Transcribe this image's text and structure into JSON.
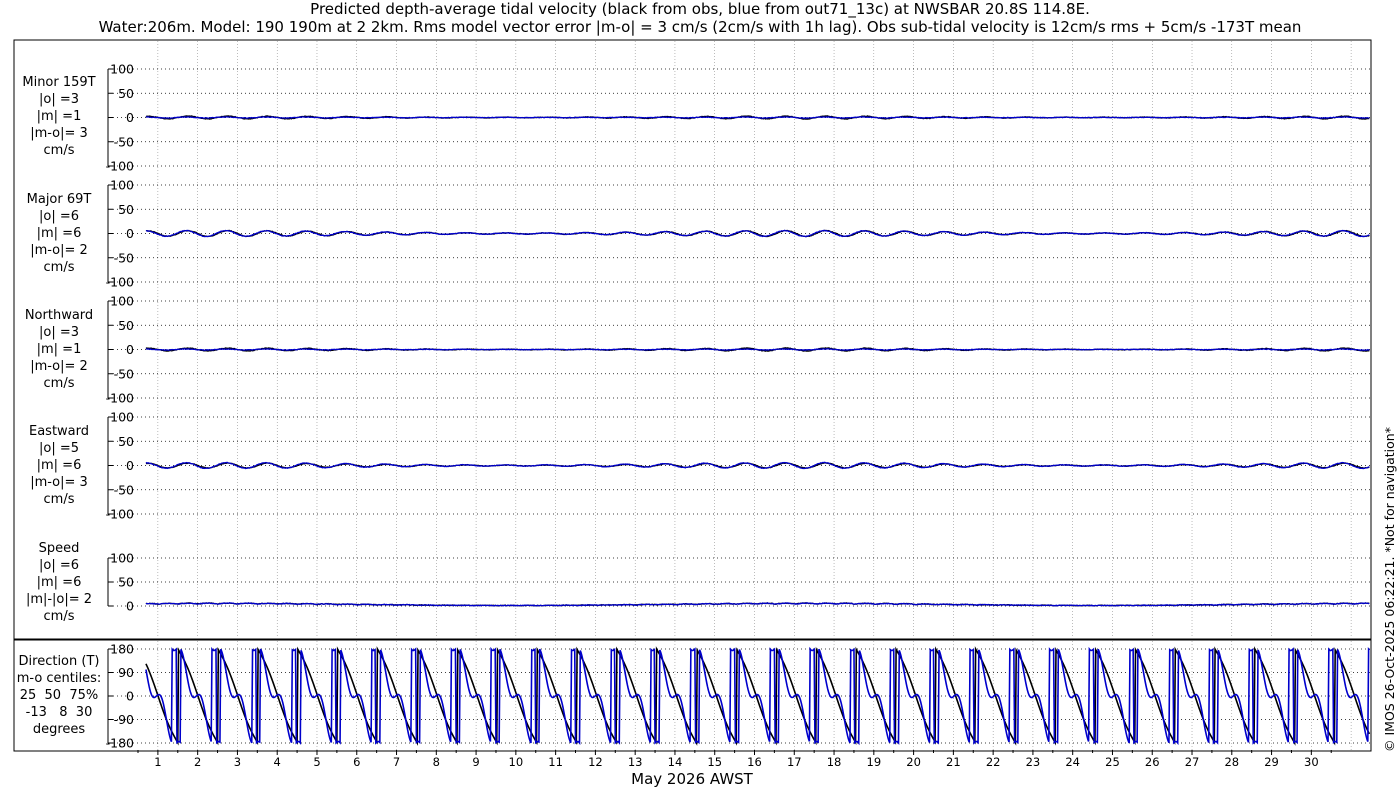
{
  "title": {
    "line1": "Predicted depth-average tidal velocity (black from obs, blue from out71_13c) at NWSBAR 20.8S 114.8E.",
    "line2": "Water:206m. Model: 190 190m at 2 2km. Rms model vector error |m-o| = 3 cm/s (2cm/s with 1h lag). Obs sub-tidal velocity is 12cm/s rms + 5cm/s -173T mean"
  },
  "credit": "© IMOS 26-Oct-2025 06:22:21. *Not for navigation*",
  "colors": {
    "obs": "#000000",
    "model": "#0000cc",
    "grid": "#7a7a7a"
  },
  "chart_data": [
    {
      "type": "line",
      "panel": "minor",
      "label_lines": [
        "Minor 159T",
        "|o| =3",
        "|m| =1",
        "|m-o|= 3",
        "cm/s"
      ],
      "yticks": [
        "100",
        "50",
        "0",
        "-50",
        "-100"
      ],
      "ylim": [
        -100,
        100
      ],
      "series": [
        {
          "name": "obs",
          "amplitude": 3
        },
        {
          "name": "model",
          "amplitude": 1
        }
      ]
    },
    {
      "type": "line",
      "panel": "major",
      "label_lines": [
        "Major 69T",
        "|o| =6",
        "|m| =6",
        "|m-o|= 2",
        "cm/s"
      ],
      "yticks": [
        "100",
        "50",
        "0",
        "-50",
        "-100"
      ],
      "ylim": [
        -100,
        100
      ],
      "series": [
        {
          "name": "obs",
          "amplitude": 6
        },
        {
          "name": "model",
          "amplitude": 6
        }
      ]
    },
    {
      "type": "line",
      "panel": "north",
      "label_lines": [
        "Northward",
        "|o| =3",
        "|m| =1",
        "|m-o|= 2",
        "cm/s"
      ],
      "yticks": [
        "100",
        "50",
        "0",
        "-50",
        "-100"
      ],
      "ylim": [
        -100,
        100
      ],
      "series": [
        {
          "name": "obs",
          "amplitude": 3
        },
        {
          "name": "model",
          "amplitude": 1
        }
      ]
    },
    {
      "type": "line",
      "panel": "east",
      "label_lines": [
        "Eastward",
        "|o| =5",
        "|m| =6",
        "|m-o|= 3",
        "cm/s"
      ],
      "yticks": [
        "100",
        "50",
        "0",
        "-50",
        "-100"
      ],
      "ylim": [
        -100,
        100
      ],
      "series": [
        {
          "name": "obs",
          "amplitude": 5
        },
        {
          "name": "model",
          "amplitude": 6
        }
      ]
    },
    {
      "type": "line",
      "panel": "speed",
      "label_lines": [
        "Speed",
        "|o| =6",
        "|m| =6",
        "|m|-|o|= 2",
        "cm/s"
      ],
      "yticks": [
        "100",
        "50",
        "0"
      ],
      "ylim": [
        0,
        100
      ],
      "series": [
        {
          "name": "obs",
          "amplitude": 6
        },
        {
          "name": "model",
          "amplitude": 6
        }
      ]
    },
    {
      "type": "line",
      "panel": "direction",
      "label_lines": [
        "Direction (T)",
        "m-o centiles:",
        "25  50  75%",
        "-13   8  30",
        "degrees"
      ],
      "yticks": [
        "180",
        "90",
        "0",
        "-90",
        "-180"
      ],
      "ylim": [
        -180,
        180
      ],
      "series": [
        {
          "name": "obs"
        },
        {
          "name": "model"
        }
      ]
    }
  ],
  "xaxis": {
    "label": "May 2026 AWST",
    "ticks": [
      "1",
      "2",
      "3",
      "4",
      "5",
      "6",
      "7",
      "8",
      "9",
      "10",
      "11",
      "12",
      "13",
      "14",
      "15",
      "16",
      "17",
      "18",
      "19",
      "20",
      "21",
      "22",
      "23",
      "24",
      "25",
      "26",
      "27",
      "28",
      "29",
      "30"
    ],
    "grid": true
  }
}
